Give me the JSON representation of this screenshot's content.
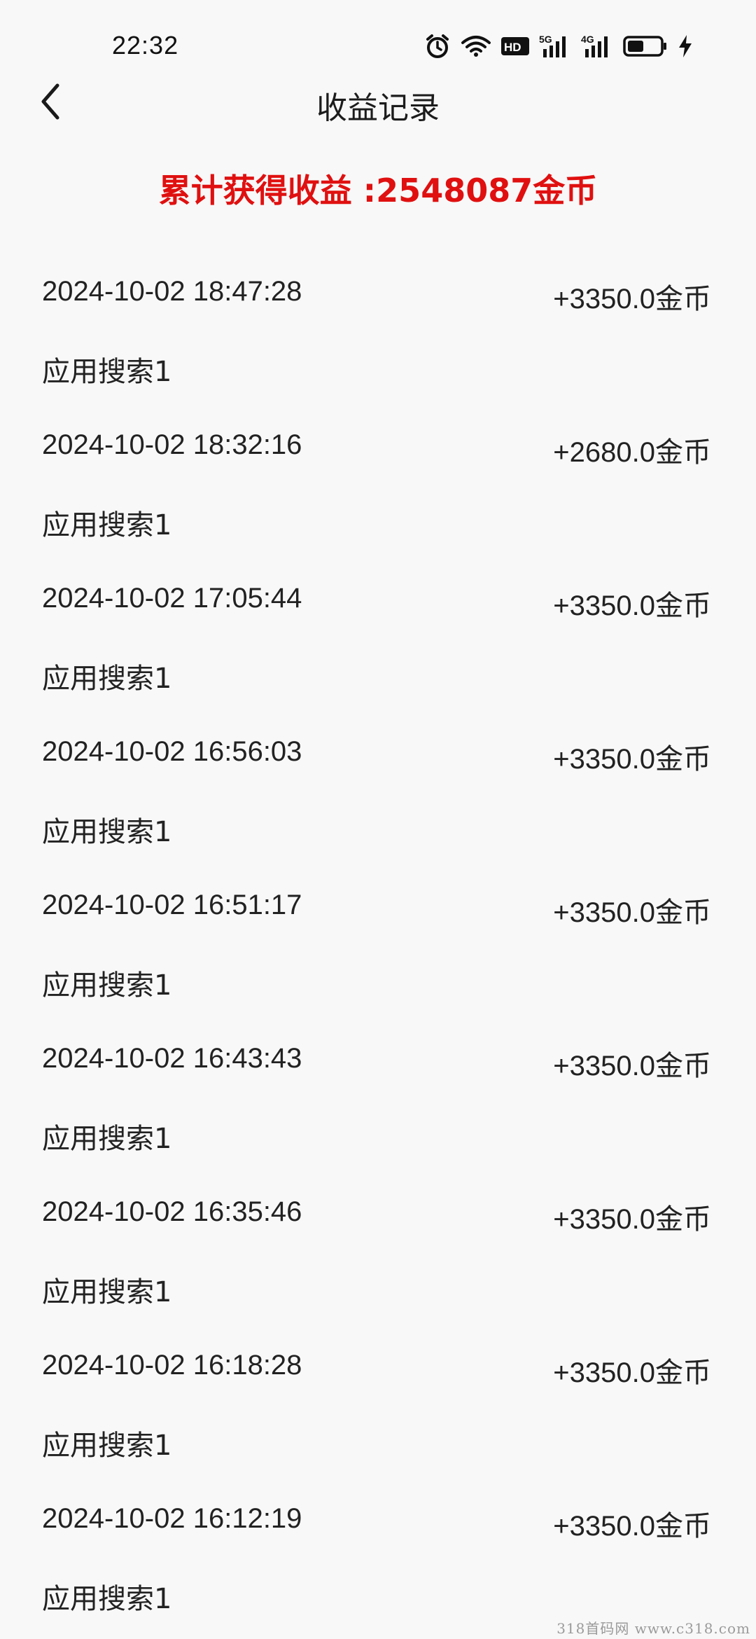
{
  "status_bar": {
    "time": "22:32",
    "icons": [
      "alarm-icon",
      "wifi-icon",
      "hd-icon",
      "signal-5g-icon",
      "signal-4g-icon",
      "battery-icon",
      "charging-icon"
    ],
    "hd_label": "HD",
    "net1_label": "5G",
    "net2_label": "4G"
  },
  "header": {
    "title": "收益记录",
    "back_icon": "chevron-left-icon"
  },
  "summary": {
    "text": "累计获得收益 :2548087金币"
  },
  "colors": {
    "accent": "#e01010",
    "background": "#f8f8f8",
    "text": "#222222"
  },
  "records": [
    {
      "time": "2024-10-02 18:47:28",
      "amount": "+3350.0金币",
      "source": "应用搜索1"
    },
    {
      "time": "2024-10-02 18:32:16",
      "amount": "+2680.0金币",
      "source": "应用搜索1"
    },
    {
      "time": "2024-10-02 17:05:44",
      "amount": "+3350.0金币",
      "source": "应用搜索1"
    },
    {
      "time": "2024-10-02 16:56:03",
      "amount": "+3350.0金币",
      "source": "应用搜索1"
    },
    {
      "time": "2024-10-02 16:51:17",
      "amount": "+3350.0金币",
      "source": "应用搜索1"
    },
    {
      "time": "2024-10-02 16:43:43",
      "amount": "+3350.0金币",
      "source": "应用搜索1"
    },
    {
      "time": "2024-10-02 16:35:46",
      "amount": "+3350.0金币",
      "source": "应用搜索1"
    },
    {
      "time": "2024-10-02 16:18:28",
      "amount": "+3350.0金币",
      "source": "应用搜索1"
    },
    {
      "time": "2024-10-02 16:12:19",
      "amount": "+3350.0金币",
      "source": "应用搜索1"
    }
  ],
  "watermark": "318首码网 www.c318.com"
}
